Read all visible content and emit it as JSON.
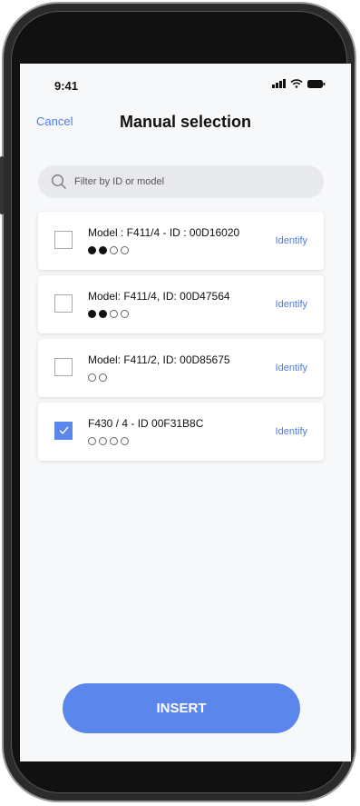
{
  "status_bar": {
    "time": "9:41"
  },
  "header": {
    "cancel_label": "Cancel",
    "title": "Manual selection"
  },
  "search": {
    "placeholder": "Filter by ID or model",
    "value": ""
  },
  "devices": [
    {
      "label": "Model : F411/4 - ID : 00D16020",
      "checked": false,
      "dots": [
        1,
        1,
        0,
        0
      ],
      "action": "Identify"
    },
    {
      "label": "Model: F411/4, ID: 00D47564",
      "checked": false,
      "dots": [
        1,
        1,
        0,
        0
      ],
      "action": "Identify"
    },
    {
      "label": "Model: F411/2, ID: 00D85675",
      "checked": false,
      "dots": [
        0,
        0
      ],
      "action": "Identify"
    },
    {
      "label": "F430 / 4 - ID 00F31B8C",
      "checked": true,
      "dots": [
        0,
        0,
        0,
        0
      ],
      "action": "Identify"
    }
  ],
  "insert_label": "INSERT",
  "colors": {
    "accent": "#5b87ec",
    "link": "#4c7be8",
    "background": "#f7f8fa"
  },
  "icons": {
    "search": "search-icon",
    "checkbox": "check-icon"
  }
}
